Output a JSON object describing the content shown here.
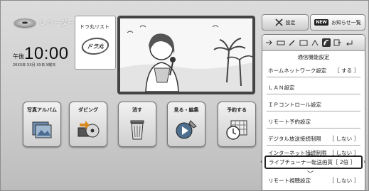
{
  "device": {
    "label": "レコーダー",
    "icon": "disc-icon"
  },
  "clock": {
    "ampm": "午後",
    "time": "10:00",
    "date": "20XX年 XX月 XX日 X曜日"
  },
  "dora": {
    "label": "ドラ丸リスト",
    "logo_text": "ドラ丸"
  },
  "top_buttons": {
    "settings_label": "設定",
    "news_badge": "NEW",
    "news_label": "お知らせ一覧"
  },
  "tiles": [
    {
      "label": "写真アルバム",
      "icon": "photo-album-icon"
    },
    {
      "label": "ダビング",
      "icon": "dubbing-icon"
    },
    {
      "label": "消す",
      "icon": "trash-icon"
    },
    {
      "label": "見る・編集",
      "icon": "play-edit-icon"
    },
    {
      "label": "予約する",
      "icon": "reserve-clock-icon"
    }
  ],
  "panel": {
    "title": "通信機能設定",
    "items": [
      {
        "label": "ホームネットワーク設定",
        "value": "［ する ］"
      },
      {
        "label": "ＬＡＮ設定",
        "value": ""
      },
      {
        "label": "ＩＰコントロール設定",
        "value": ""
      },
      {
        "label": "リモート予約設定",
        "value": ""
      },
      {
        "label": "デジタル放送接続制限",
        "value": "［ しない ］"
      },
      {
        "label": "インターネット接続制限",
        "value": "［ しない ］"
      },
      {
        "label": "ライブチューナー転送画質",
        "value": "［ 2倍 ］"
      },
      {
        "label": "リモート視聴設定",
        "value": "［ しない ］"
      }
    ]
  },
  "colors": {
    "background": "#d3d3d3",
    "focus_border": "#222222",
    "panel_bg": "#ffffff"
  }
}
